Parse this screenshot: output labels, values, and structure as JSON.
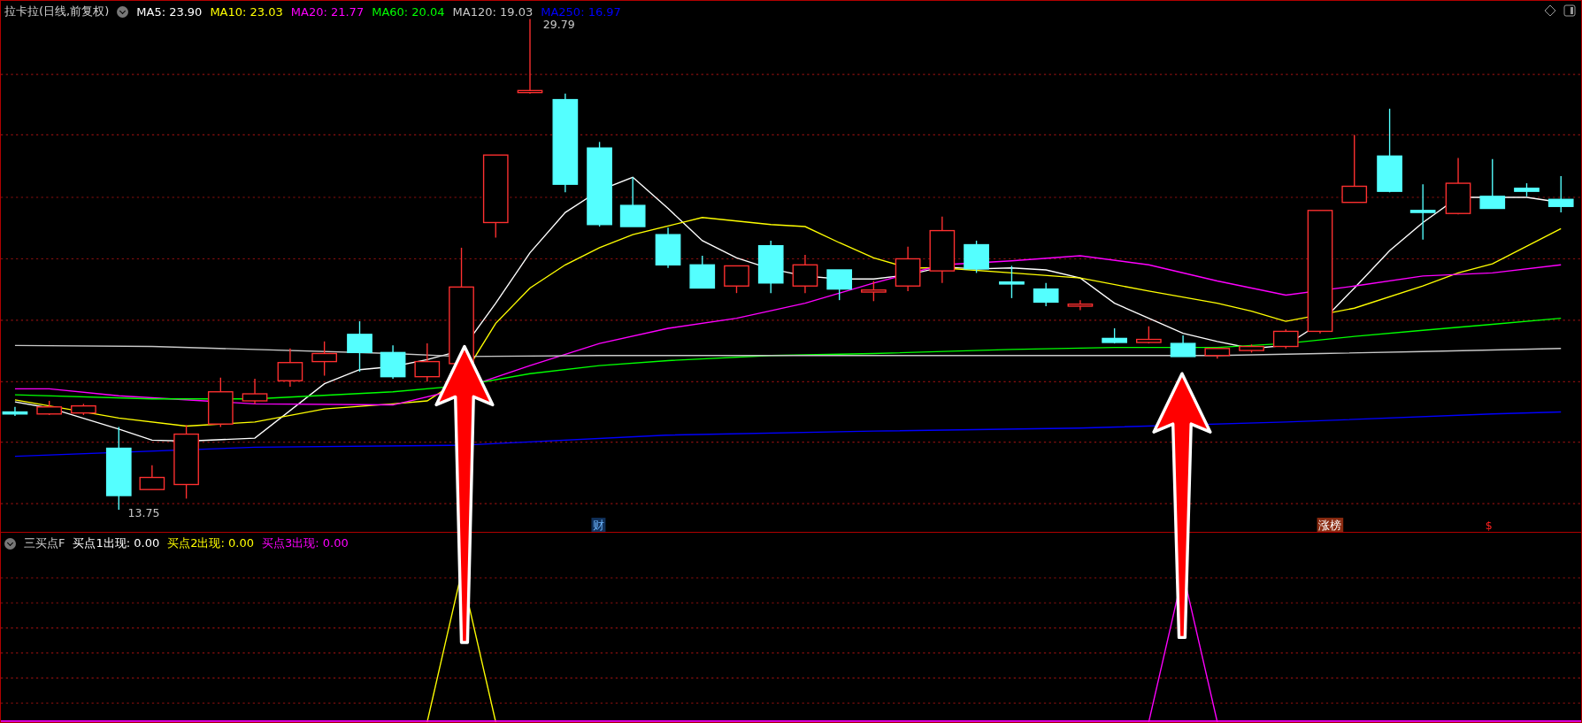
{
  "main_panel": {
    "title": "拉卡拉(日线,前复权)",
    "indicators": [
      {
        "label": "MA5: 23.90",
        "color": "#ffffff"
      },
      {
        "label": "MA10: 23.03",
        "color": "#ffff00"
      },
      {
        "label": "MA20: 21.77",
        "color": "#ff00ff"
      },
      {
        "label": "MA60: 20.04",
        "color": "#00ff00"
      },
      {
        "label": "MA120: 19.03",
        "color": "#c8c8c8"
      },
      {
        "label": "MA250: 16.97",
        "color": "#0000ff"
      }
    ],
    "high_label": "29.79",
    "low_label": "13.75",
    "event_markers": [
      {
        "text": "财",
        "kind": "finance"
      },
      {
        "text": "涨榜",
        "kind": "ranking"
      },
      {
        "text": "$",
        "kind": "dollar"
      }
    ]
  },
  "indicator_panel": {
    "title": "三买点F",
    "indicators": [
      {
        "label": "买点1出现: 0.00",
        "color": "#ffffff"
      },
      {
        "label": "买点2出现: 0.00",
        "color": "#ffff00"
      },
      {
        "label": "买点3出现: 0.00",
        "color": "#ff00ff"
      }
    ]
  }
}
